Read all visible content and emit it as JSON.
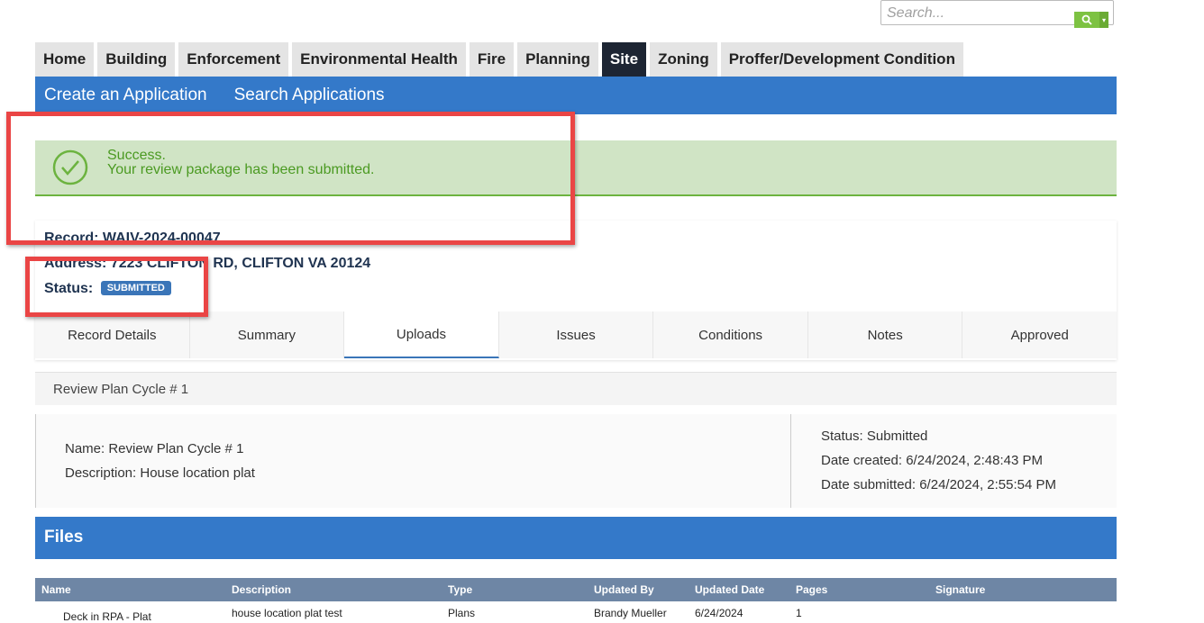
{
  "search": {
    "placeholder": "Search..."
  },
  "top_tabs": [
    {
      "label": "Home"
    },
    {
      "label": "Building"
    },
    {
      "label": "Enforcement"
    },
    {
      "label": "Environmental Health"
    },
    {
      "label": "Fire"
    },
    {
      "label": "Planning"
    },
    {
      "label": "Site",
      "active": true
    },
    {
      "label": "Zoning"
    },
    {
      "label": "Proffer/Development Condition"
    }
  ],
  "subnav": {
    "create": "Create an Application",
    "search": "Search Applications"
  },
  "alert": {
    "title": "Success.",
    "message": "Your review package has been submitted.",
    "color": "#4b9a22"
  },
  "record": {
    "record_label": "Record: WAIV-2024-00047",
    "address_label": "Address: 7223 CLIFTON RD, CLIFTON VA 20124",
    "status_label": "Status:",
    "status_badge": "SUBMITTED"
  },
  "detail_tabs": [
    "Record Details",
    "Summary",
    "Uploads",
    "Issues",
    "Conditions",
    "Notes",
    "Approved"
  ],
  "cycle": {
    "header": "Review Plan Cycle # 1",
    "name": "Name: Review Plan Cycle # 1",
    "description": "Description: House location plat",
    "status": "Status: Submitted",
    "created": "Date created: 6/24/2024, 2:48:43 PM",
    "submitted": "Date submitted: 6/24/2024, 2:55:54 PM"
  },
  "files": {
    "title": "Files",
    "columns": [
      "Name",
      "Description",
      "Type",
      "Updated By",
      "Updated Date",
      "Pages",
      "Signature"
    ],
    "rows": [
      {
        "name": "Deck in RPA - Plat",
        "description": "house location plat test",
        "type": "Plans",
        "updated_by": "Brandy Mueller",
        "updated_date": "6/24/2024",
        "pages": "1",
        "signature": ""
      }
    ]
  },
  "colors": {
    "nav_blue": "#3479c9",
    "active_tab": "#1d2533",
    "annotation_red": "#ea4545",
    "badge_blue": "#3a75b8"
  }
}
